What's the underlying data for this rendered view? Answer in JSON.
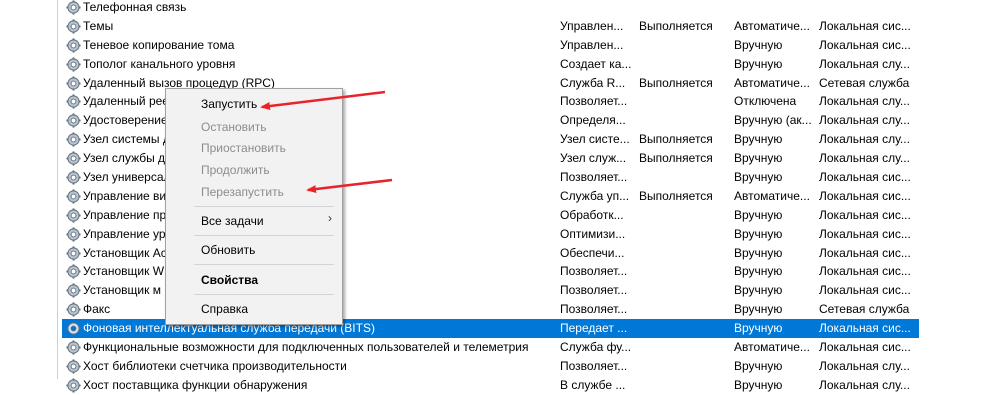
{
  "services": [
    {
      "name": "Телефонная связь",
      "desc": "",
      "status": "",
      "startup": "",
      "logon": ""
    },
    {
      "name": "Темы",
      "desc": "Управлен...",
      "status": "Выполняется",
      "startup": "Автоматиче...",
      "logon": "Локальная сис..."
    },
    {
      "name": "Теневое копирование тома",
      "desc": "Управлен...",
      "status": "",
      "startup": "Вручную",
      "logon": "Локальная сис..."
    },
    {
      "name": "Тополог канального уровня",
      "desc": "Создает ка...",
      "status": "",
      "startup": "Вручную",
      "logon": "Локальная слу..."
    },
    {
      "name": "Удаленный вызов процедур (RPC)",
      "desc": "Служба R...",
      "status": "Выполняется",
      "startup": "Автоматиче...",
      "logon": "Сетевая служба"
    },
    {
      "name": "Удаленный рее",
      "desc": "Позволяет...",
      "status": "",
      "startup": "Отключена",
      "logon": "Локальная слу..."
    },
    {
      "name": "Удостоверение",
      "desc": "Определя...",
      "status": "",
      "startup": "Вручную (ак...",
      "logon": "Локальная слу..."
    },
    {
      "name": "Узел системы д",
      "desc": "Узел систе...",
      "status": "Выполняется",
      "startup": "Вручную",
      "logon": "Локальная слу..."
    },
    {
      "name": "Узел службы д",
      "desc": "Узел служ...",
      "status": "Выполняется",
      "startup": "Вручную",
      "logon": "Локальная слу..."
    },
    {
      "name": "Узел универсал",
      "desc": "Позволяет...",
      "status": "",
      "startup": "Вручную",
      "logon": "Локальная сис..."
    },
    {
      "name": "Управление ви",
      "desc": "Служба уп...",
      "status": "Выполняется",
      "startup": "Автоматиче...",
      "logon": "Локальная сис..."
    },
    {
      "name": "Управление пр",
      "desc": "Обработк...",
      "status": "",
      "startup": "Вручную",
      "logon": "Локальная сис..."
    },
    {
      "name": "Управление ур",
      "desc": "Оптимизи...",
      "status": "",
      "startup": "Вручную",
      "logon": "Локальная сис..."
    },
    {
      "name": "Установщик Ac",
      "desc": "Обеспечи...",
      "status": "",
      "startup": "Вручную",
      "logon": "Локальная сис..."
    },
    {
      "name": "Установщик W",
      "desc": "Позволяет...",
      "status": "",
      "startup": "Вручную",
      "logon": "Локальная сис..."
    },
    {
      "name": "Установщик м",
      "desc": "Позволяет...",
      "status": "",
      "startup": "Вручную",
      "logon": "Локальная сис..."
    },
    {
      "name": "Факс",
      "desc": "Позволяет...",
      "status": "",
      "startup": "Вручную",
      "logon": "Сетевая служба"
    },
    {
      "name": "Фоновая интеллектуальная служба передачи (BITS)",
      "desc": "Передает ...",
      "status": "",
      "startup": "Вручную",
      "logon": "Локальная сис...",
      "selected": true
    },
    {
      "name": "Функциональные возможности для подключенных пользователей и телеметрия",
      "desc": "Служба фу...",
      "status": "",
      "startup": "Автоматиче...",
      "logon": "Локальная сис..."
    },
    {
      "name": "Хост библиотеки счетчика производительности",
      "desc": "Позволяет...",
      "status": "",
      "startup": "Вручную",
      "logon": "Локальная слу..."
    },
    {
      "name": "Хост поставщика функции обнаружения",
      "desc": "В службе ...",
      "status": "",
      "startup": "Вручную",
      "logon": "Локальная слу..."
    }
  ],
  "context_menu": {
    "start": "Запустить",
    "stop": "Остановить",
    "pause": "Приостановить",
    "resume": "Продолжить",
    "restart": "Перезапустить",
    "all_tasks": "Все задачи",
    "refresh": "Обновить",
    "properties": "Свойства",
    "help": "Справка",
    "submenu_glyph": "›"
  },
  "colors": {
    "selection": "#0078d7",
    "annotation_arrow": "#e8242a",
    "disabled_text": "#8c8c8c"
  },
  "icons": {
    "service": "gear-icon",
    "annotation": "red-arrow"
  }
}
